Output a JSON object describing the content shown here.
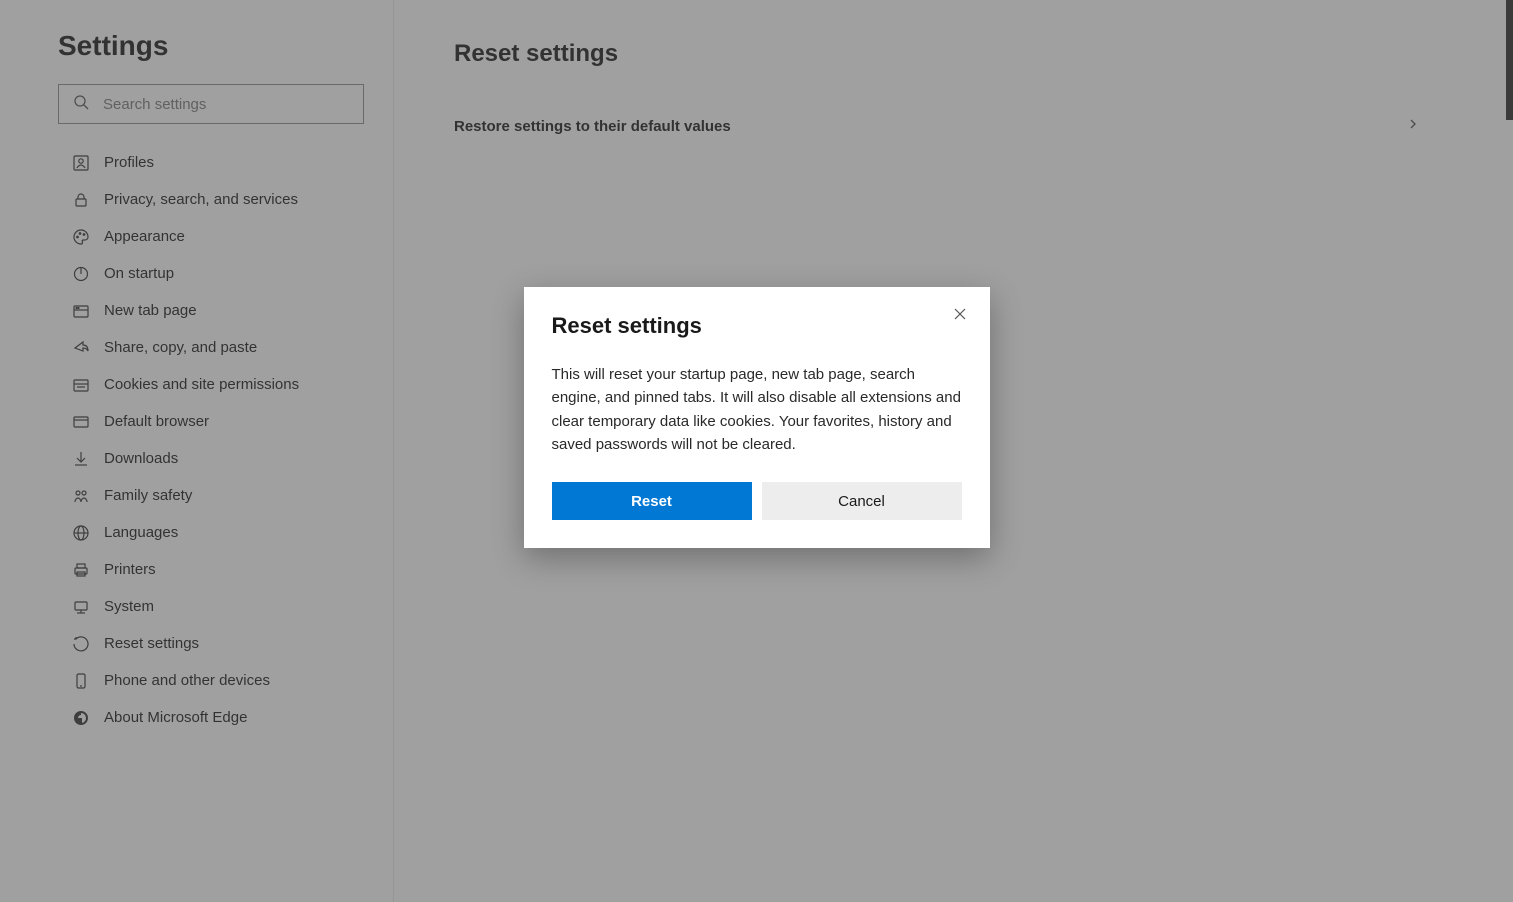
{
  "sidebar": {
    "title": "Settings",
    "search_placeholder": "Search settings",
    "items": [
      {
        "label": "Profiles",
        "icon": "profiles"
      },
      {
        "label": "Privacy, search, and services",
        "icon": "privacy"
      },
      {
        "label": "Appearance",
        "icon": "appearance"
      },
      {
        "label": "On startup",
        "icon": "startup"
      },
      {
        "label": "New tab page",
        "icon": "newtab"
      },
      {
        "label": "Share, copy, and paste",
        "icon": "share"
      },
      {
        "label": "Cookies and site permissions",
        "icon": "cookies"
      },
      {
        "label": "Default browser",
        "icon": "default-browser"
      },
      {
        "label": "Downloads",
        "icon": "downloads"
      },
      {
        "label": "Family safety",
        "icon": "family"
      },
      {
        "label": "Languages",
        "icon": "languages"
      },
      {
        "label": "Printers",
        "icon": "printers"
      },
      {
        "label": "System",
        "icon": "system"
      },
      {
        "label": "Reset settings",
        "icon": "reset"
      },
      {
        "label": "Phone and other devices",
        "icon": "phone"
      },
      {
        "label": "About Microsoft Edge",
        "icon": "about"
      }
    ]
  },
  "main": {
    "title": "Reset settings",
    "row_label": "Restore settings to their default values"
  },
  "modal": {
    "title": "Reset settings",
    "body": "This will reset your startup page, new tab page, search engine, and pinned tabs. It will also disable all extensions and clear temporary data like cookies. Your favorites, history and saved passwords will not be cleared.",
    "primary": "Reset",
    "secondary": "Cancel"
  }
}
